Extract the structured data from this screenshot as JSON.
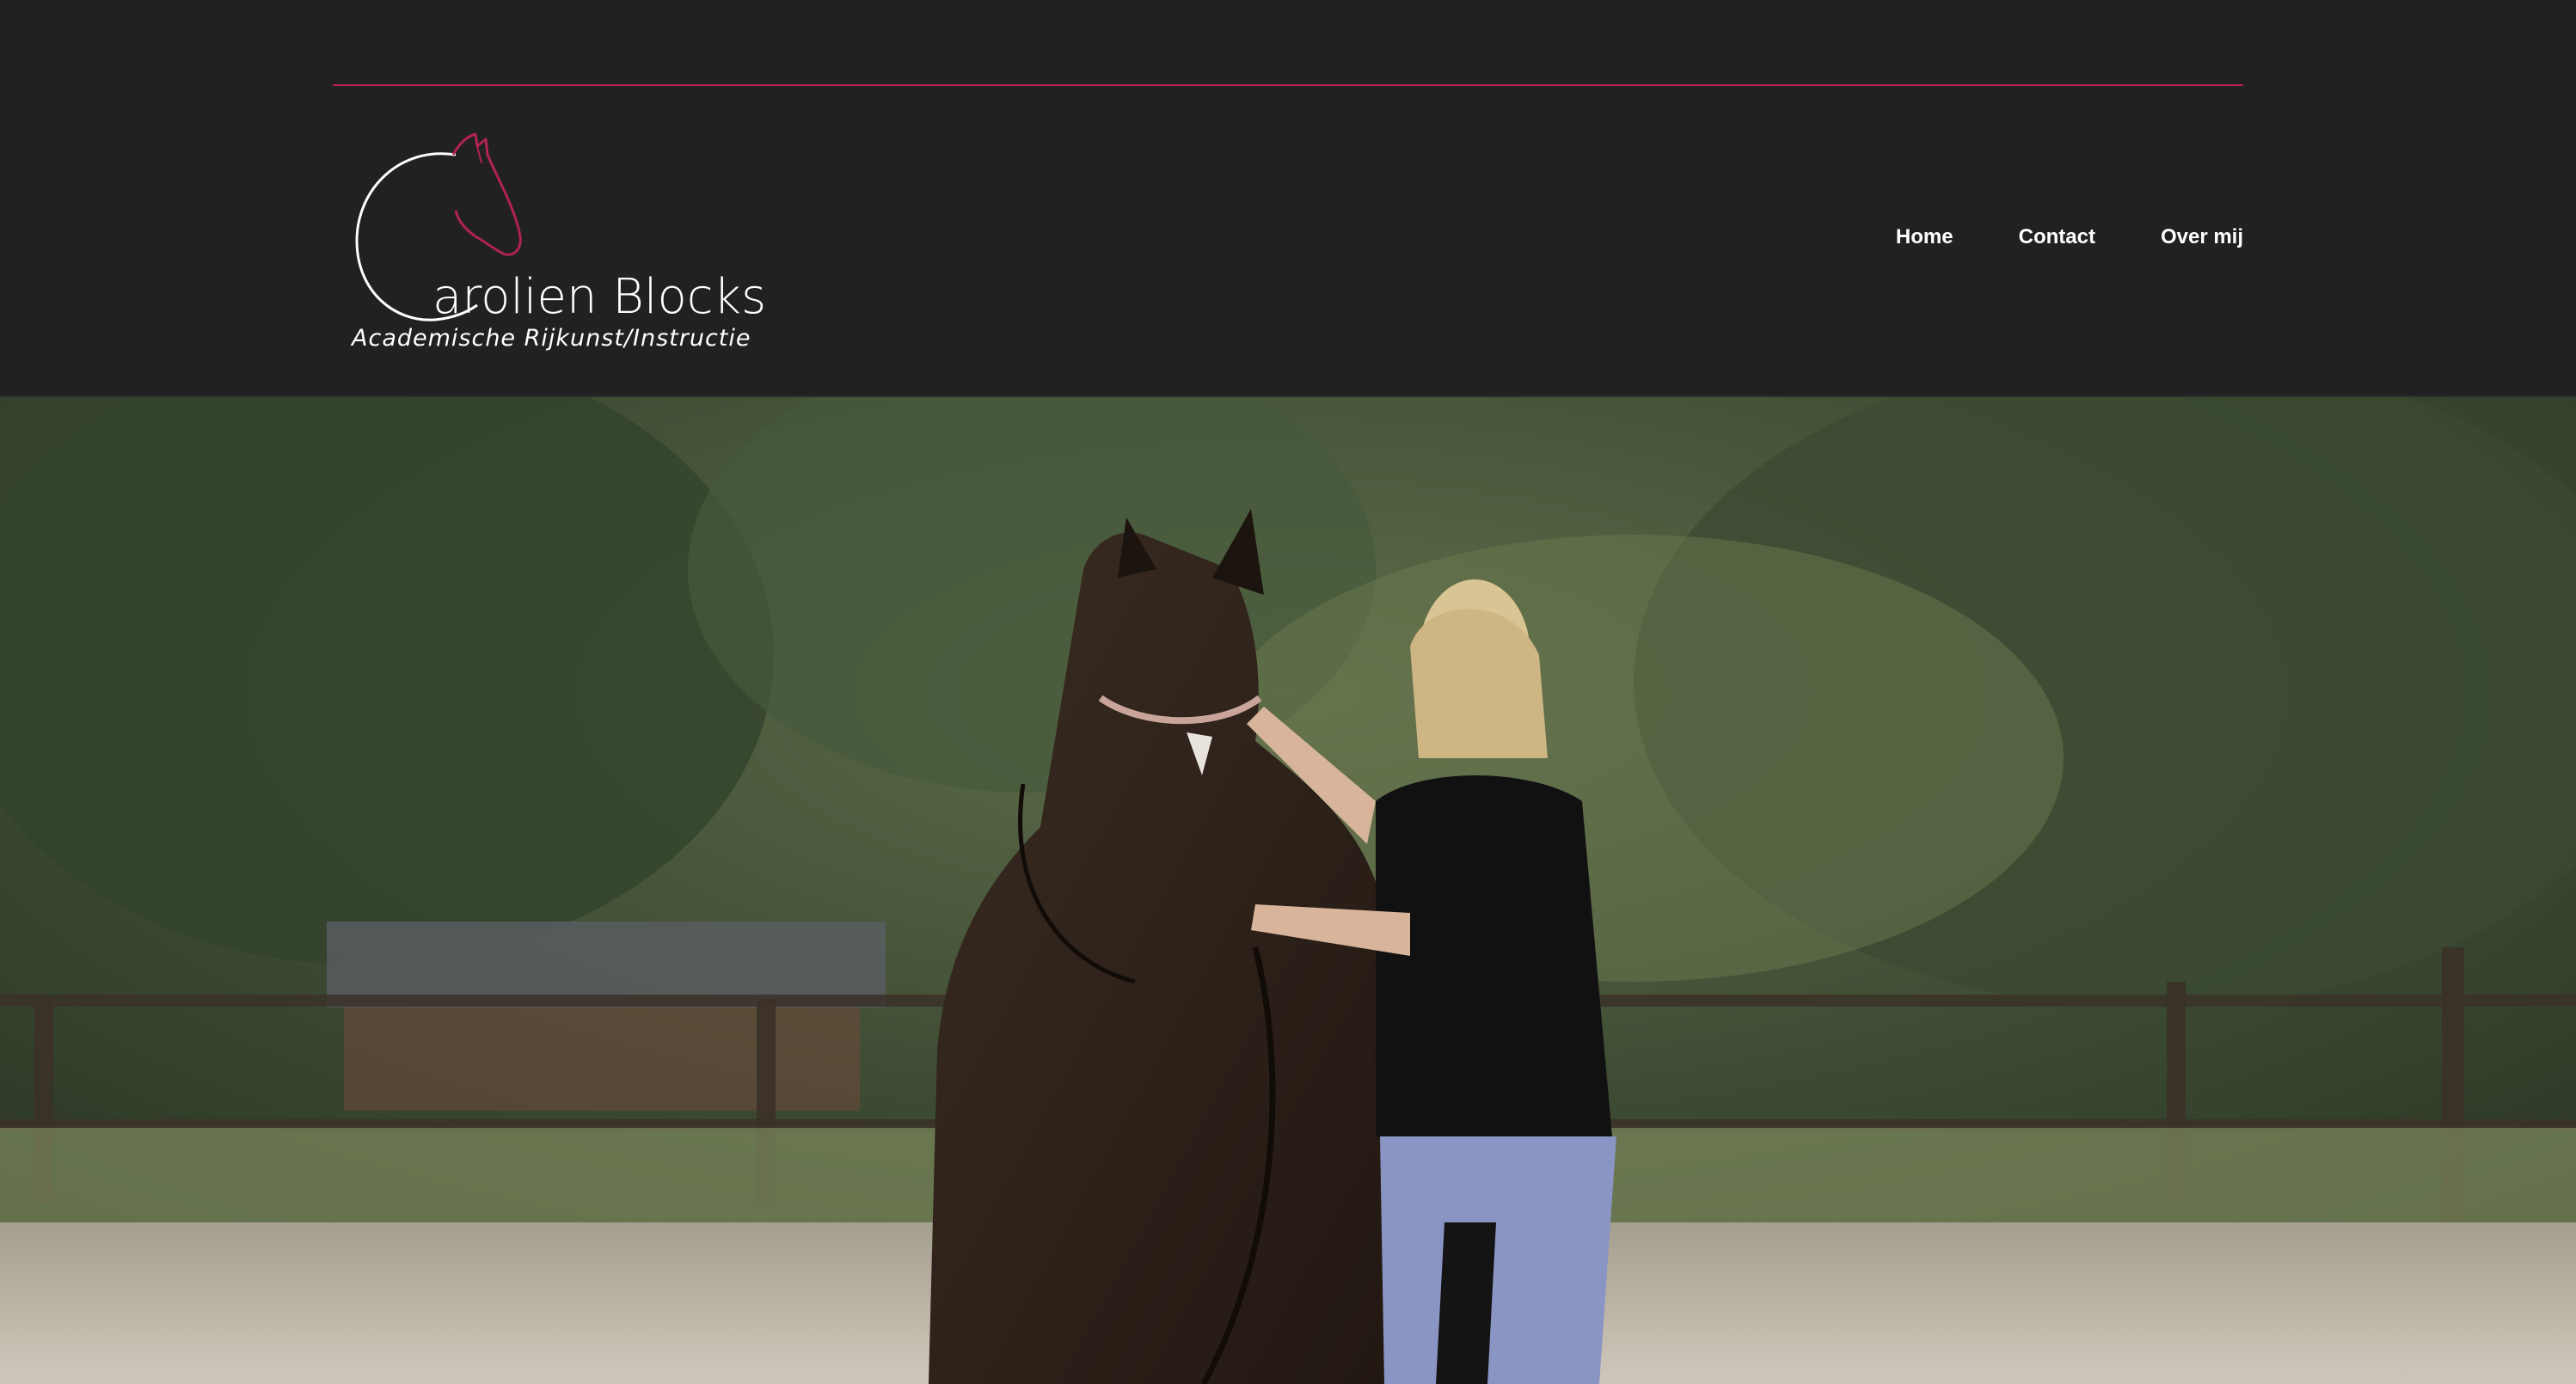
{
  "brand": {
    "name": "arolien Blocks",
    "tagline": "Academische Rijkunst/Instructie"
  },
  "nav": {
    "items": [
      {
        "label": "Home"
      },
      {
        "label": "Contact"
      },
      {
        "label": "Over mij"
      }
    ]
  },
  "hero": {
    "image": "woman-with-horse-photo"
  },
  "colors": {
    "header_bg": "#212121",
    "accent": "#b2234f",
    "text": "#ffffff"
  }
}
